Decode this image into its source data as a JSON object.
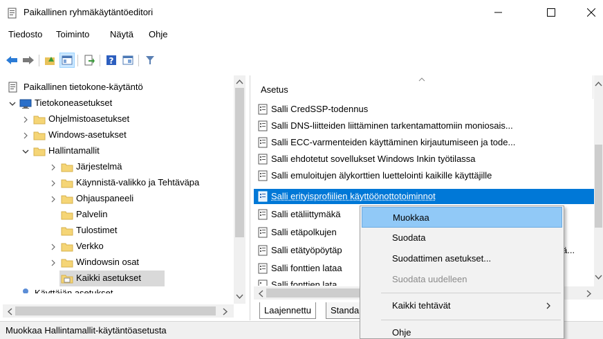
{
  "window": {
    "title": "Paikallinen ryhmäkäytäntöeditori",
    "icon": "policy-document-icon"
  },
  "menubar": {
    "items": [
      {
        "label": "Tiedosto"
      },
      {
        "label": "Toiminto"
      },
      {
        "label": "Näytä"
      },
      {
        "label": "Ohje"
      }
    ]
  },
  "toolbar": {
    "icons": [
      "back-arrow-icon",
      "forward-arrow-icon",
      "up-folder-icon",
      "show-hide-tree-icon",
      "export-list-icon",
      "help-icon",
      "extended-view-icon",
      "filter-icon"
    ]
  },
  "tree": {
    "items": [
      {
        "label": "Paikallinen tietokone-käytäntö",
        "icon": "policy-document-icon"
      },
      {
        "label": "Tietokoneasetukset",
        "icon": "computer-icon"
      },
      {
        "label": "Ohjelmistoasetukset",
        "icon": "folder-icon"
      },
      {
        "label": "Windows-asetukset",
        "icon": "folder-icon"
      },
      {
        "label": "Hallintamallit",
        "icon": "folder-icon"
      },
      {
        "label": "Järjestelmä",
        "icon": "folder-icon"
      },
      {
        "label": "Käynnistä-valikko ja Tehtäväpa",
        "icon": "folder-icon"
      },
      {
        "label": "Ohjauspaneeli",
        "icon": "folder-icon"
      },
      {
        "label": "Palvelin",
        "icon": "folder-icon"
      },
      {
        "label": "Tulostimet",
        "icon": "folder-icon"
      },
      {
        "label": "Verkko",
        "icon": "folder-icon"
      },
      {
        "label": "Windowsin osat",
        "icon": "folder-icon"
      },
      {
        "label": "Kaikki asetukset",
        "icon": "all-settings-folder-icon"
      },
      {
        "label": "Käyttäjän asetukset",
        "icon": "user-icon"
      }
    ]
  },
  "list": {
    "column_header": "Asetus",
    "rows": [
      {
        "label": "Salli CredSSP-todennus"
      },
      {
        "label": "Salli DNS-liitteiden liittäminen tarkentamattomiin moniosais..."
      },
      {
        "label": "Salli ECC-varmenteiden käyttäminen kirjautumiseen ja tode..."
      },
      {
        "label": "Salli ehdotetut sovellukset Windows Inkin työtilassa"
      },
      {
        "label": "Salli emuloitujen älykorttien luettelointi kaikille käyttäjille"
      },
      {
        "label": "Salli erityisprofiilien käyttöönottotoiminnot"
      },
      {
        "label": "Salli etäliittymäkä"
      },
      {
        "label": "Salli etäpolkujen"
      },
      {
        "label": "Salli etätyöpöytäp"
      },
      {
        "label": "Salli fonttien lataa"
      },
      {
        "label": "Salli fonttien lata"
      }
    ],
    "truncated_suffix": "ä..."
  },
  "tabs": {
    "items": [
      {
        "label": "Laajennettu"
      },
      {
        "label": "Standardi"
      }
    ]
  },
  "context_menu": {
    "items": [
      {
        "label": "Muokkaa"
      },
      {
        "label": "Suodata"
      },
      {
        "label": "Suodattimen asetukset..."
      },
      {
        "label": "Suodata uudelleen"
      },
      {
        "label": "Kaikki tehtävät"
      },
      {
        "label": "Ohje"
      }
    ]
  },
  "statusbar": {
    "text": "Muokkaa Hallintamallit-käytäntöasetusta"
  },
  "colors": {
    "selection": "#0078d7",
    "menu_highlight": "#91c9f7",
    "folder": "#f5d576"
  }
}
